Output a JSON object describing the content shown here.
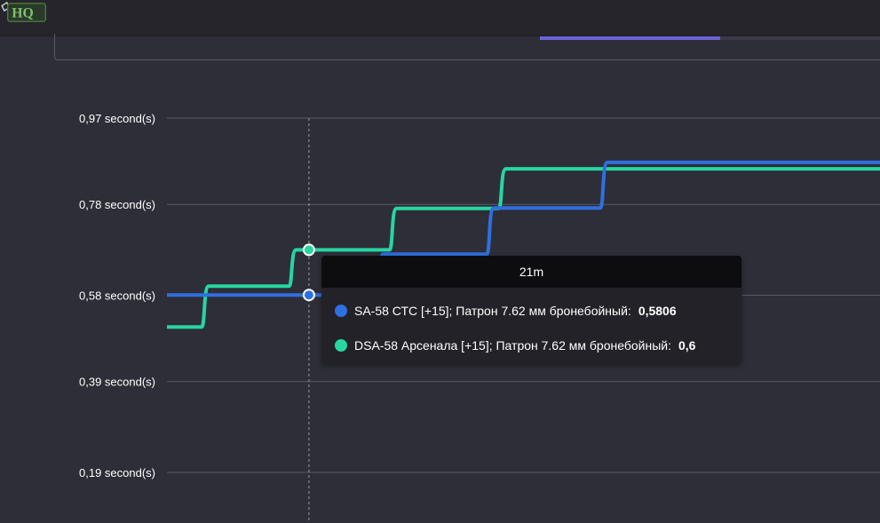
{
  "header": {
    "logo_text": "HQ",
    "progress_fraction": 0.53
  },
  "colors": {
    "series1": "#2f6fe0",
    "series2": "#27d6a1",
    "grid": "#5a5a64",
    "background": "#2e2e38"
  },
  "tooltip": {
    "title": "21m",
    "rows": [
      {
        "label": "SA-58 СТС [+15]; Патрон 7.62 мм бронебойный:",
        "value": "0,5806",
        "color": "#2f6fe0"
      },
      {
        "label": "DSA-58 Арсенала [+15]; Патрон 7.62 мм бронебойный:",
        "value": "0,6",
        "color": "#27d6a1"
      }
    ]
  },
  "chart_data": {
    "type": "line",
    "step": true,
    "xlabel": "",
    "ylabel": "",
    "y_ticks": [
      0.19,
      0.39,
      0.58,
      0.78,
      0.97
    ],
    "y_tick_labels": [
      "0,19 second(s)",
      "0,39 second(s)",
      "0,58 second(s)",
      "0,78 second(s)",
      "0,97 second(s)"
    ],
    "grid": true,
    "hover_x": "21m",
    "series": [
      {
        "name": "SA-58 СТС [+15]; Патрон 7.62 мм бронебойный",
        "color": "#2f6fe0",
        "points": [
          [
            0,
            0.5806
          ],
          [
            1,
            0.5806
          ],
          [
            2,
            0.6703
          ],
          [
            3,
            0.7721
          ],
          [
            4,
            0.8726
          ],
          [
            5,
            0.8726
          ]
        ],
        "step_at": [
          0.96,
          1.95,
          2.96,
          4.0
        ]
      },
      {
        "name": "DSA-58 Арсенала [+15]; Патрон 7.62 мм бронебойный",
        "color": "#27d6a1",
        "points": [
          [
            0,
            0.51
          ],
          [
            1,
            0.6
          ],
          [
            2,
            0.6799
          ],
          [
            3,
            0.7712
          ],
          [
            4,
            0.8584
          ],
          [
            5,
            0.8584
          ]
        ],
        "step_at": [
          0.35,
          1.15,
          2.07,
          3.07
        ]
      }
    ]
  }
}
